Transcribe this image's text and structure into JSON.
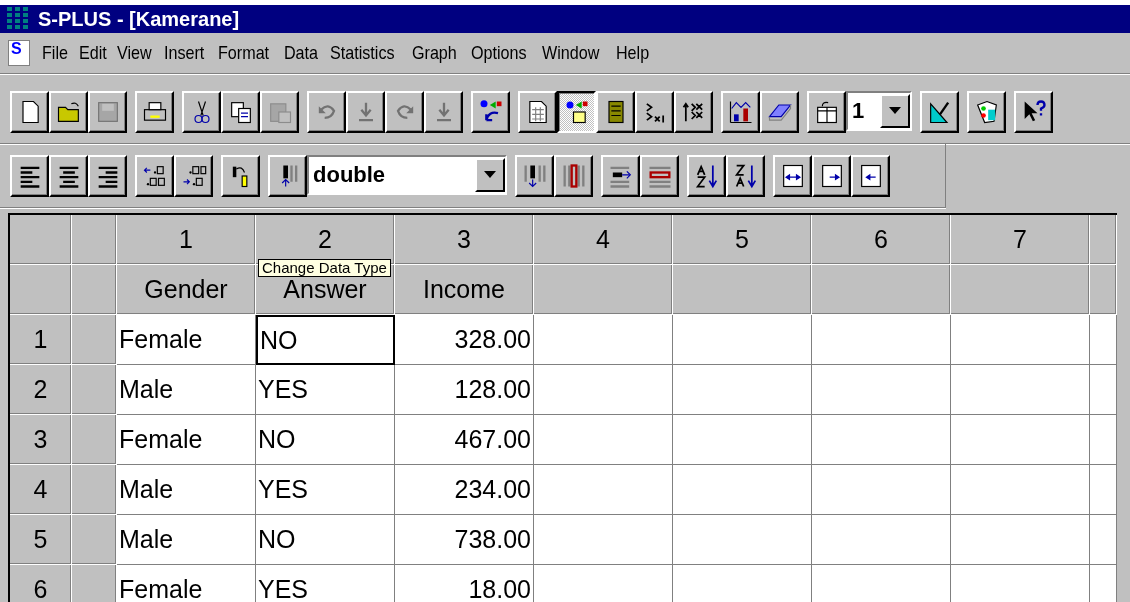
{
  "window": {
    "title": "S-PLUS - [Kamerane]"
  },
  "menu_bar": {
    "badge": "S",
    "items": [
      {
        "label": "File"
      },
      {
        "label": "Edit"
      },
      {
        "label": "View"
      },
      {
        "label": "Insert"
      },
      {
        "label": "Format"
      },
      {
        "label": "Data"
      },
      {
        "label": "Statistics"
      },
      {
        "label": "Graph"
      },
      {
        "label": "Options"
      },
      {
        "label": "Window"
      },
      {
        "label": "Help"
      }
    ]
  },
  "toolbar_main": [
    [
      {
        "kind": "button",
        "disabled": false,
        "pressed": false
      },
      {
        "kind": "button",
        "disabled": false,
        "pressed": false
      },
      {
        "kind": "button",
        "disabled": true,
        "pressed": false
      }
    ],
    [
      {
        "kind": "button",
        "disabled": false,
        "pressed": false
      }
    ],
    [
      {
        "kind": "button",
        "disabled": false,
        "pressed": false
      },
      {
        "kind": "button",
        "disabled": false,
        "pressed": false
      },
      {
        "kind": "button",
        "disabled": true,
        "pressed": false
      }
    ],
    [
      {
        "kind": "button",
        "disabled": true,
        "pressed": false
      },
      {
        "kind": "button",
        "disabled": true,
        "pressed": false
      },
      {
        "kind": "button",
        "disabled": true,
        "pressed": false
      },
      {
        "kind": "button",
        "disabled": true,
        "pressed": false
      }
    ],
    [
      {
        "kind": "button",
        "disabled": false,
        "pressed": false
      }
    ],
    [
      {
        "kind": "button",
        "disabled": false,
        "pressed": false
      },
      {
        "kind": "button",
        "disabled": false,
        "pressed": true
      },
      {
        "kind": "button",
        "disabled": false,
        "pressed": false
      },
      {
        "kind": "button",
        "disabled": false,
        "pressed": false
      },
      {
        "kind": "button",
        "disabled": false,
        "pressed": false
      }
    ],
    [
      {
        "kind": "button",
        "disabled": false,
        "pressed": false
      },
      {
        "kind": "button",
        "disabled": false,
        "pressed": false
      }
    ],
    [
      {
        "kind": "button",
        "disabled": false,
        "pressed": false
      },
      {
        "kind": "combo",
        "value": "1"
      }
    ],
    [
      {
        "kind": "button",
        "disabled": false,
        "pressed": false
      }
    ],
    [
      {
        "kind": "button",
        "disabled": false,
        "pressed": false
      }
    ],
    [
      {
        "kind": "button",
        "disabled": false,
        "pressed": false
      }
    ]
  ],
  "toolbar_format": [
    [
      {
        "kind": "button",
        "disabled": false,
        "pressed": false
      },
      {
        "kind": "button",
        "disabled": false,
        "pressed": false
      },
      {
        "kind": "button",
        "disabled": false,
        "pressed": false
      }
    ],
    [
      {
        "kind": "button",
        "disabled": false,
        "pressed": false
      },
      {
        "kind": "button",
        "disabled": false,
        "pressed": false
      }
    ],
    [
      {
        "kind": "button",
        "disabled": false,
        "pressed": false
      }
    ],
    [
      {
        "kind": "button",
        "disabled": false,
        "pressed": false
      },
      {
        "kind": "combo",
        "value": "double"
      }
    ],
    [
      {
        "kind": "button",
        "disabled": false,
        "pressed": false
      },
      {
        "kind": "button",
        "disabled": false,
        "pressed": false
      }
    ],
    [
      {
        "kind": "button",
        "disabled": false,
        "pressed": false
      },
      {
        "kind": "button",
        "disabled": false,
        "pressed": false
      }
    ],
    [
      {
        "kind": "button",
        "disabled": false,
        "pressed": false
      },
      {
        "kind": "button",
        "disabled": false,
        "pressed": false
      }
    ],
    [
      {
        "kind": "button",
        "disabled": false,
        "pressed": false
      },
      {
        "kind": "button",
        "disabled": false,
        "pressed": false
      },
      {
        "kind": "button",
        "disabled": false,
        "pressed": false
      }
    ]
  ],
  "sheet": {
    "columns": [
      "1",
      "2",
      "3",
      "4",
      "5",
      "6",
      "7"
    ],
    "column_names": [
      "Gender",
      "Answer",
      "Income"
    ],
    "rows": [
      {
        "label": "1",
        "cells": [
          {
            "text": "Female",
            "selected": false
          },
          {
            "text": "NO",
            "selected": true
          },
          {
            "text": "328.00",
            "selected": false
          }
        ]
      },
      {
        "label": "2",
        "cells": [
          {
            "text": "Male",
            "selected": false
          },
          {
            "text": "YES",
            "selected": false
          },
          {
            "text": "128.00",
            "selected": false
          }
        ]
      },
      {
        "label": "3",
        "cells": [
          {
            "text": "Female",
            "selected": false
          },
          {
            "text": "NO",
            "selected": false
          },
          {
            "text": "467.00",
            "selected": false
          }
        ]
      },
      {
        "label": "4",
        "cells": [
          {
            "text": "Male",
            "selected": false
          },
          {
            "text": "YES",
            "selected": false
          },
          {
            "text": "234.00",
            "selected": false
          }
        ]
      },
      {
        "label": "5",
        "cells": [
          {
            "text": "Male",
            "selected": false
          },
          {
            "text": "NO",
            "selected": false
          },
          {
            "text": "738.00",
            "selected": false
          }
        ]
      },
      {
        "label": "6",
        "cells": [
          {
            "text": "Female",
            "selected": false
          },
          {
            "text": "YES",
            "selected": false
          },
          {
            "text": "18.00",
            "selected": false
          }
        ]
      }
    ]
  },
  "tooltip": {
    "text": "Change Data Type"
  }
}
